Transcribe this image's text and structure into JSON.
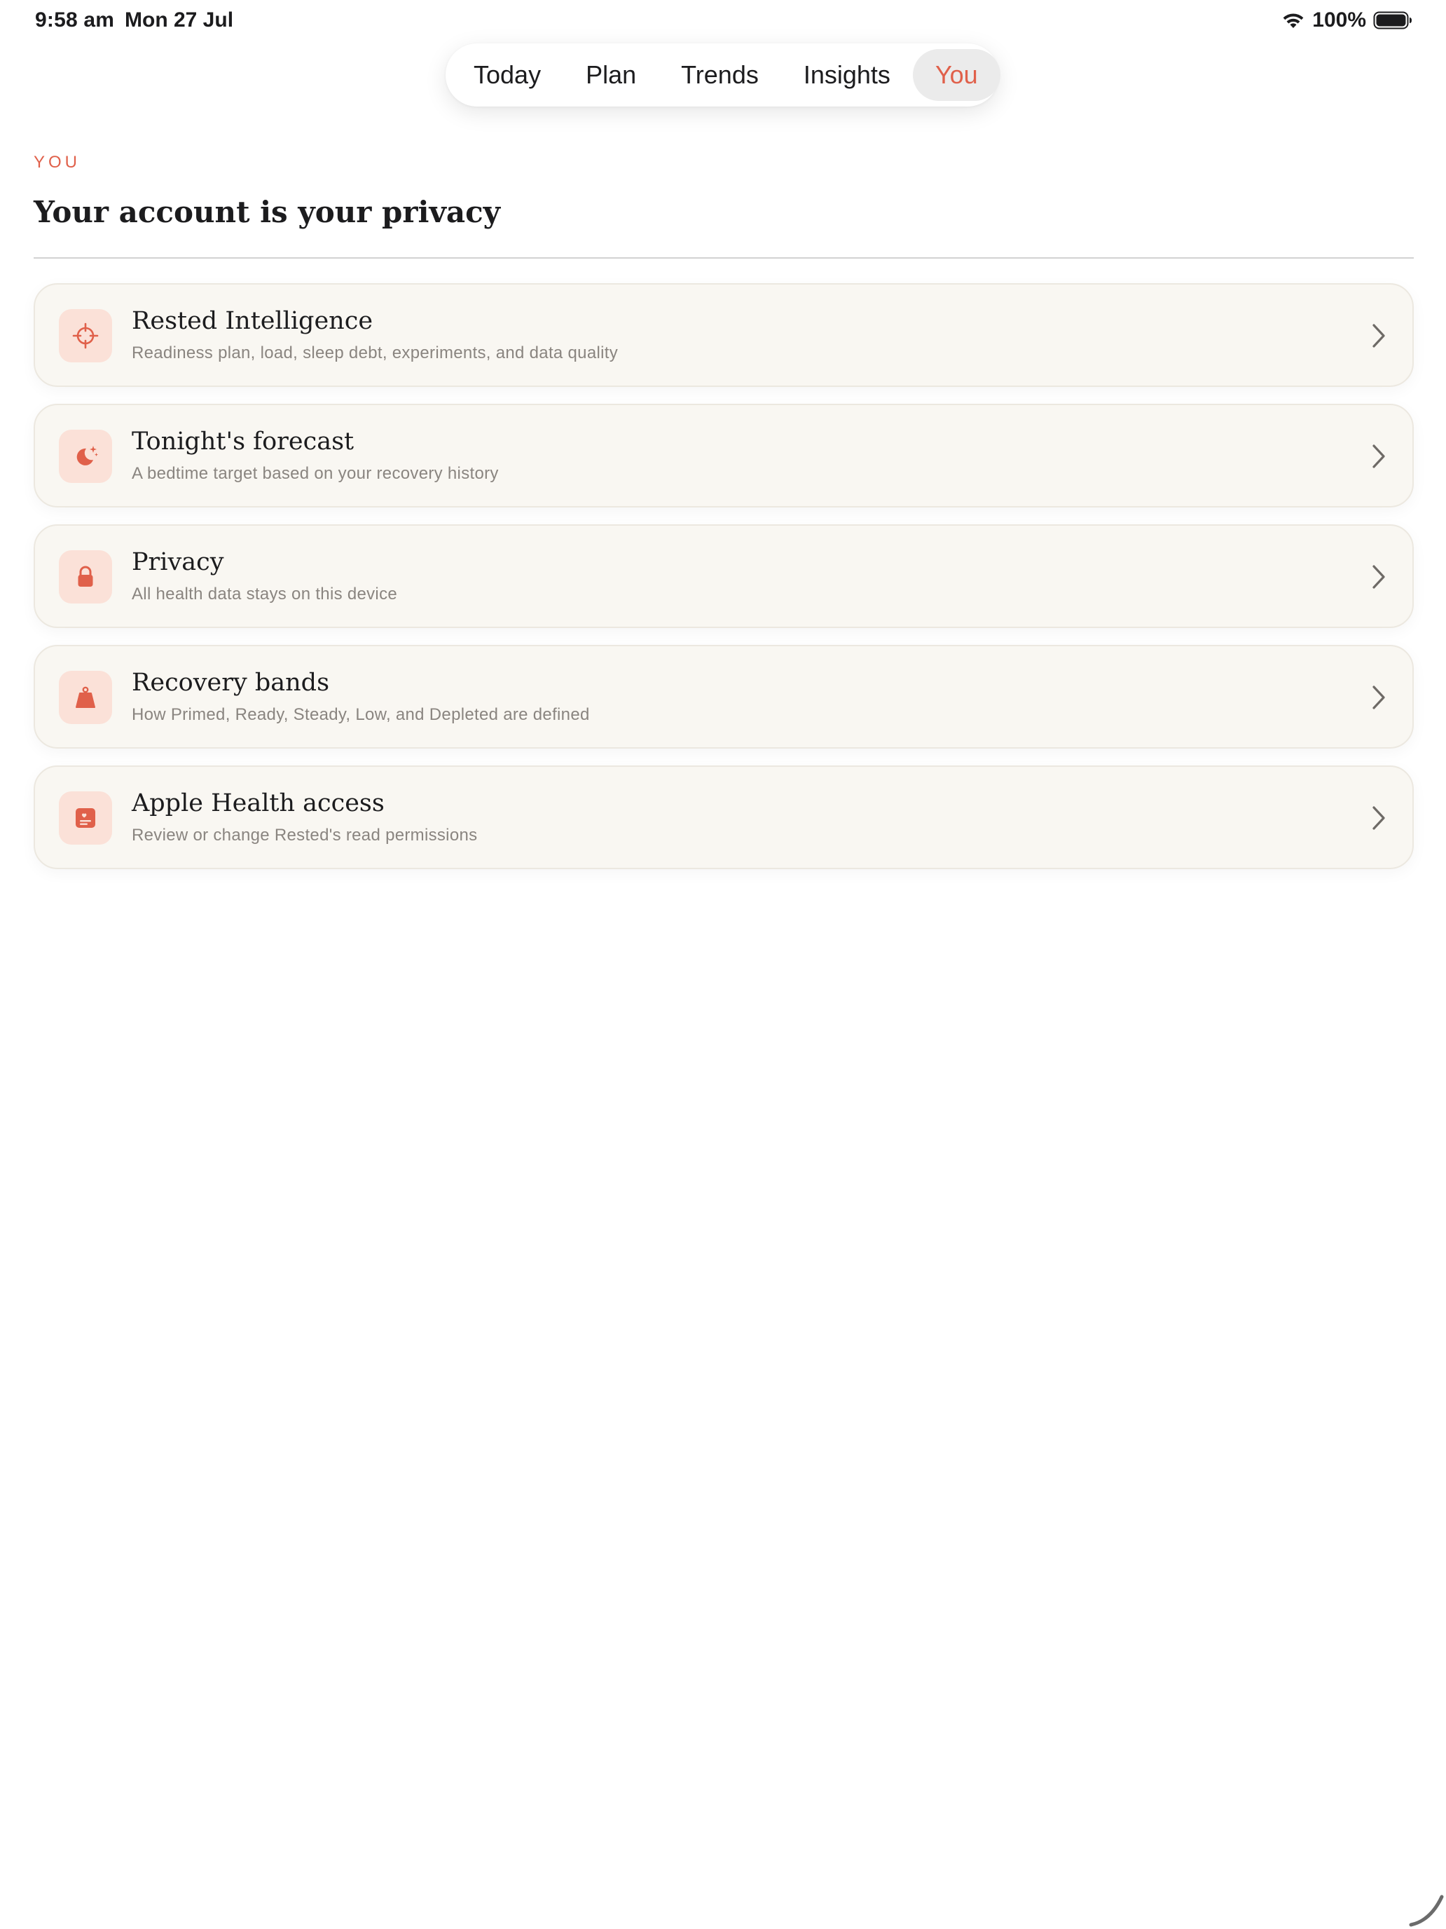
{
  "status_bar": {
    "time": "9:58 am",
    "date": "Mon 27 Jul",
    "battery_percent": "100%",
    "battery_level": 1.0,
    "icons": [
      "wifi-icon",
      "battery-icon"
    ]
  },
  "tabs": [
    {
      "label": "Today",
      "active": false
    },
    {
      "label": "Plan",
      "active": false
    },
    {
      "label": "Trends",
      "active": false
    },
    {
      "label": "Insights",
      "active": false
    },
    {
      "label": "You",
      "active": true
    }
  ],
  "header": {
    "eyebrow": "YOU",
    "title": "Your account is your privacy"
  },
  "items": [
    {
      "title": "Rested Intelligence",
      "subtitle": "Readiness plan, load, sleep debt, experiments, and data quality",
      "icon": "crosshair-icon"
    },
    {
      "title": "Tonight's forecast",
      "subtitle": "A bedtime target based on your recovery history",
      "icon": "moon-stars-icon"
    },
    {
      "title": "Privacy",
      "subtitle": "All health data stays on this device",
      "icon": "lock-icon"
    },
    {
      "title": "Recovery bands",
      "subtitle": "How Primed, Ready, Steady, Low, and Depleted are defined",
      "icon": "weight-icon"
    },
    {
      "title": "Apple Health access",
      "subtitle": "Review or change Rested's read permissions",
      "icon": "health-record-icon"
    }
  ],
  "colors": {
    "accent": "#e0604a",
    "icon_bg": "#fbe1d8",
    "card_bg": "#f9f7f2",
    "card_border": "#ece8e0",
    "active_tab_bg": "#ebebeb"
  }
}
